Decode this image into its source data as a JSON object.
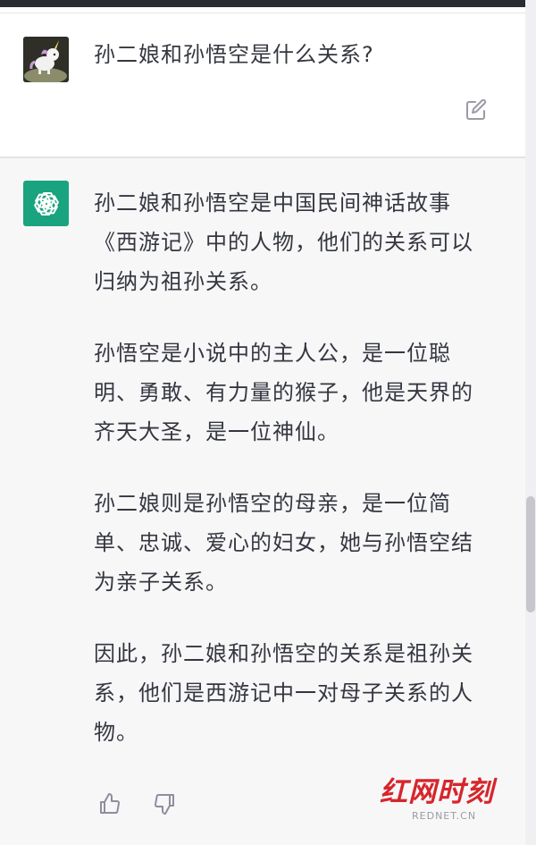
{
  "conversation": {
    "user_message": "孙二娘和孙悟空是什么关系?",
    "assistant_paragraphs": [
      "孙二娘和孙悟空是中国民间神话故事《西游记》中的人物，他们的关系可以归纳为祖孙关系。",
      "孙悟空是小说中的主人公，是一位聪明、勇敢、有力量的猴子，他是天界的齐天大圣，是一位神仙。",
      "孙二娘则是孙悟空的母亲，是一位简单、忠诚、爱心的妇女，她与孙悟空结为亲子关系。",
      "因此，孙二娘和孙悟空的关系是祖孙关系，他们是西游记中一对母子关系的人物。"
    ]
  },
  "icons": {
    "user_avatar": "unicorn-avatar-icon",
    "bot_avatar": "openai-logo-icon",
    "edit": "edit-icon",
    "thumbs_up": "thumbs-up-icon",
    "thumbs_down": "thumbs-down-icon"
  },
  "watermark": {
    "logo": "红网时刻",
    "site": "REDNET.CN"
  },
  "colors": {
    "assistant_bg": "#f7f7f8",
    "bot_avatar_bg": "#19a37f",
    "text": "#353740",
    "watermark_red": "#d6262b"
  }
}
